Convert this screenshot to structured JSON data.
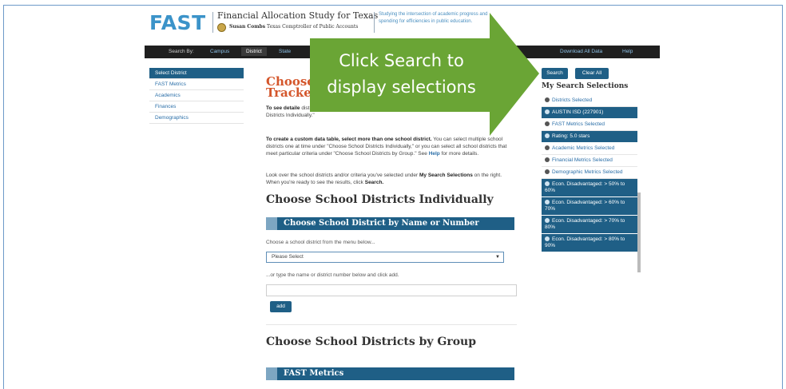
{
  "header": {
    "logo": "FAST",
    "title": "Financial Allocation Study for Texas",
    "subtitle_name": "Susan Combs",
    "subtitle_role": "Texas Comptroller of Public Accounts",
    "tagline": "Studying the intersection of academic progress and spending for efficiencies in public education."
  },
  "nav": {
    "search_by": "Search By:",
    "campus": "Campus",
    "district": "District",
    "state": "State",
    "download": "Download All Data",
    "help": "Help"
  },
  "left_menu": [
    "Select District",
    "FAST Metrics",
    "Academics",
    "Finances",
    "Demographics"
  ],
  "main": {
    "title": "Choose Tracke",
    "para1_bold": "To see detaile",
    "para1_rest": "district from the dropdown or type its name or district number under \"Choose School Districts Individually.\"",
    "para2_bold": "To create a custom data table, select more than one school district.",
    "para2_rest": "You can select multiple school districts one at time under \"Choose School Districts Individually,\" or you can select all school districts that meet particular criteria under \"Choose School Districts by Group.\" See",
    "para2_link": "Help",
    "para2_end": "for more details.",
    "para3_start": "Look over the school districts and/or criteria you've selected under",
    "para3_bold": "My Search Selections",
    "para3_mid": "on the right. When you're ready to see the results, click",
    "para3_link": "Search.",
    "h_individually": "Choose School Districts Individually",
    "bar_name": "Choose School District by Name or Number",
    "menu_hint": "Choose a school district from the menu below...",
    "select_value": "Please Select",
    "type_hint": "...or type the name or district number below and click add.",
    "add_label": "add",
    "h_group": "Choose School Districts by Group",
    "bar_metrics": "FAST Metrics"
  },
  "right": {
    "search": "Search",
    "clear": "Clear All",
    "title": "My Search Selections",
    "items": [
      {
        "text": "Districts Selected",
        "dark": false
      },
      {
        "text": "AUSTIN ISD (227901)",
        "dark": true
      },
      {
        "text": "FAST Metrics Selected",
        "dark": false
      },
      {
        "text": "Rating: 5.0 stars",
        "dark": true
      },
      {
        "text": "Academic Metrics Selected",
        "dark": false
      },
      {
        "text": "Financial Metrics Selected",
        "dark": false
      },
      {
        "text": "Demographic Metrics Selected",
        "dark": false
      },
      {
        "text": "Econ. Disadvantaged: > 50% to 60%",
        "dark": true
      },
      {
        "text": "Econ. Disadvantaged: > 60% to 70%",
        "dark": true
      },
      {
        "text": "Econ. Disadvantaged: > 70% to 80%",
        "dark": true
      },
      {
        "text": "Econ. Disadvantaged: > 80% to 90%",
        "dark": true
      }
    ]
  },
  "callout": {
    "line1": "Click Search to",
    "line2": "display selections",
    "color": "#6aa535"
  }
}
